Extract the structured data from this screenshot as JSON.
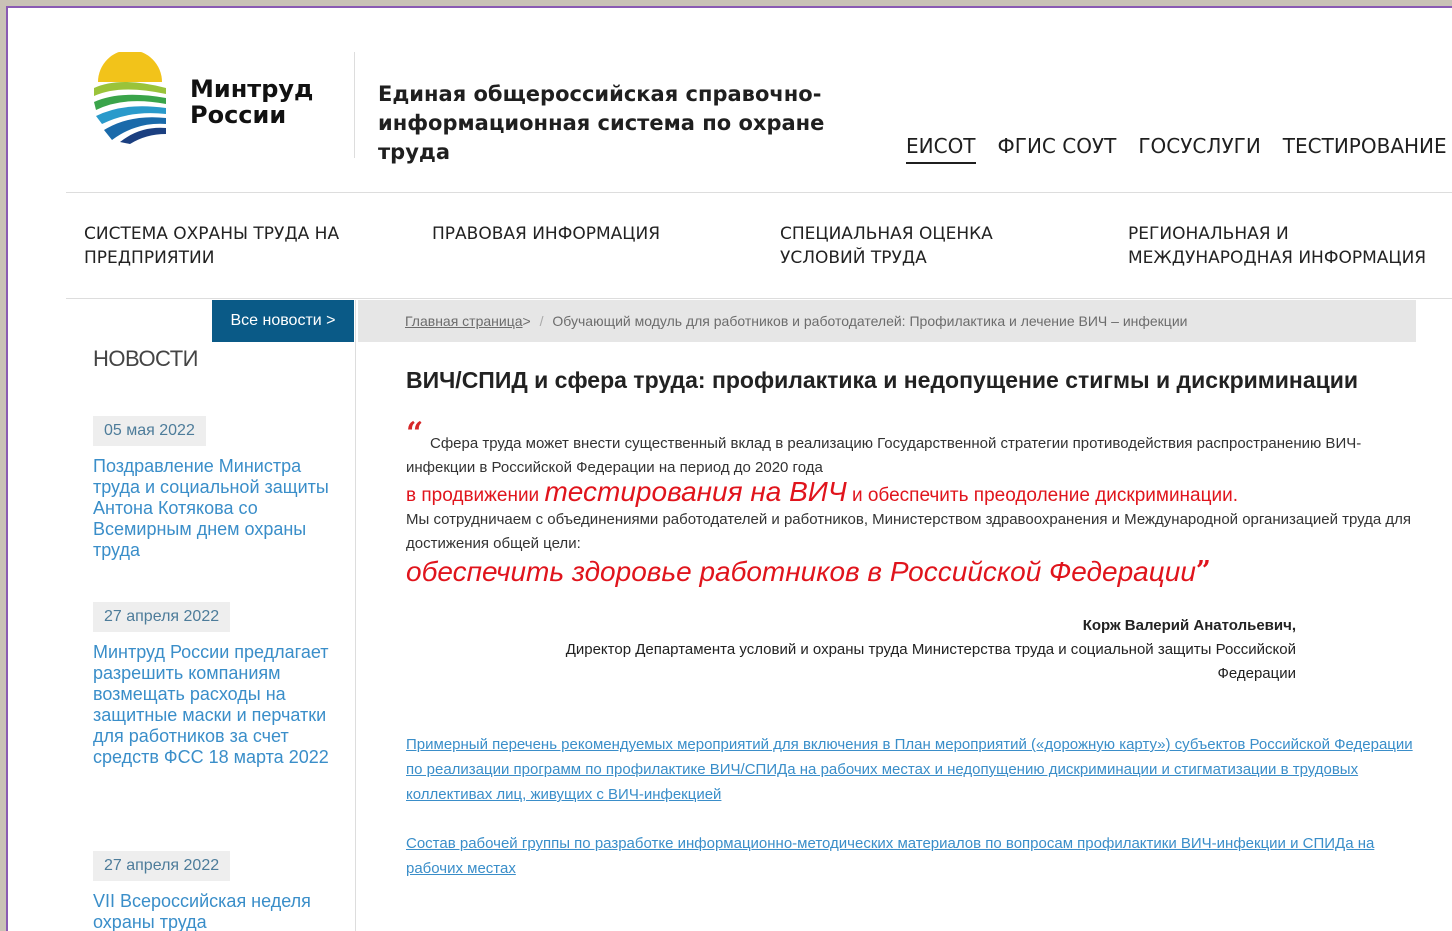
{
  "header": {
    "logo_text": [
      "Минтруд",
      "России"
    ],
    "site_title": "Единая общероссийская справочно-информационная система по охране труда",
    "top_links": [
      {
        "label": "ЕИСОТ",
        "active": true
      },
      {
        "label": "ФГИС СОУТ",
        "active": false
      },
      {
        "label": "ГОСУСЛУГИ",
        "active": false
      },
      {
        "label": "ТЕСТИРОВАНИЕ",
        "active": false
      }
    ]
  },
  "main_nav": [
    "СИСТЕМА ОХРАНЫ ТРУДА НА ПРЕДПРИЯТИИ",
    "ПРАВОВАЯ ИНФОРМАЦИЯ",
    "СПЕЦИАЛЬНАЯ ОЦЕНКА УСЛОВИЙ ТРУДА",
    "РЕГИОНАЛЬНАЯ И МЕЖДУНАРОДНАЯ ИНФОРМАЦИЯ"
  ],
  "sidebar": {
    "all_news_label": "Все новости >",
    "heading": "НОВОСТИ",
    "news": [
      {
        "date": "05 мая 2022",
        "title": "Поздравление Министра труда и социальной защиты Антона Котякова со Всемирным днем охраны труда"
      },
      {
        "date": "27 апреля 2022",
        "title": "Минтруд России предлагает разрешить компаниям возмещать расходы на защитные маски и перчатки для работников за счет средств ФСС 18 марта 2022"
      },
      {
        "date": "27 апреля 2022",
        "title": "VII Всероссийская неделя охраны труда"
      }
    ]
  },
  "breadcrumb": {
    "home": "Главная страница",
    "arrow": ">",
    "separator": "/",
    "current": "Обучающий модуль для работников и работодателей: Профилактика и лечение ВИЧ – инфекции"
  },
  "content": {
    "title": "ВИЧ/СПИД и сфера труда: профилактика и недопущение стигмы и дискриминации",
    "quote_open": "“",
    "quote_p1": "Сфера труда может внести существенный вклад в реализацию Государственной стратегии противодействия распространению ВИЧ-инфекции в Российской Федерации на период до 2020 года",
    "quote_p2_pre": "в продвижении ",
    "quote_p2_big": "тестирования на ВИЧ",
    "quote_p2_post": " и обеспечить преодоление дискриминации.",
    "quote_p3": "Мы сотрудничаем с объединениями работодателей и работников, Министерством здравоохранения и Международной организацией труда для достижения общей цели:",
    "quote_p4": "обеспечить здоровье работников в Российской Федерации",
    "quote_close": "”",
    "author_name": "Корж Валерий Анатольевич,",
    "author_position": "Директор Департамента условий и охраны труда Министерства труда и социальной защиты Российской Федерации",
    "links": [
      "Примерный перечень рекомендуемых мероприятий для включения в План мероприятий («дорожную карту») субъектов Российской Федерации по реализации программ по профилактике ВИЧ/СПИДа на рабочих местах и недопущению дискриминации и стигматизации в трудовых коллективах лиц, живущих с ВИЧ-инфекцией",
      "Состав рабочей группы по разработке информационно-методических материалов по вопросам профилактики ВИЧ-инфекции и СПИДа на рабочих местах"
    ]
  },
  "colors": {
    "accent_blue": "#0a5a87",
    "link_blue": "#3a8ec9",
    "quote_red": "#e0141c"
  }
}
